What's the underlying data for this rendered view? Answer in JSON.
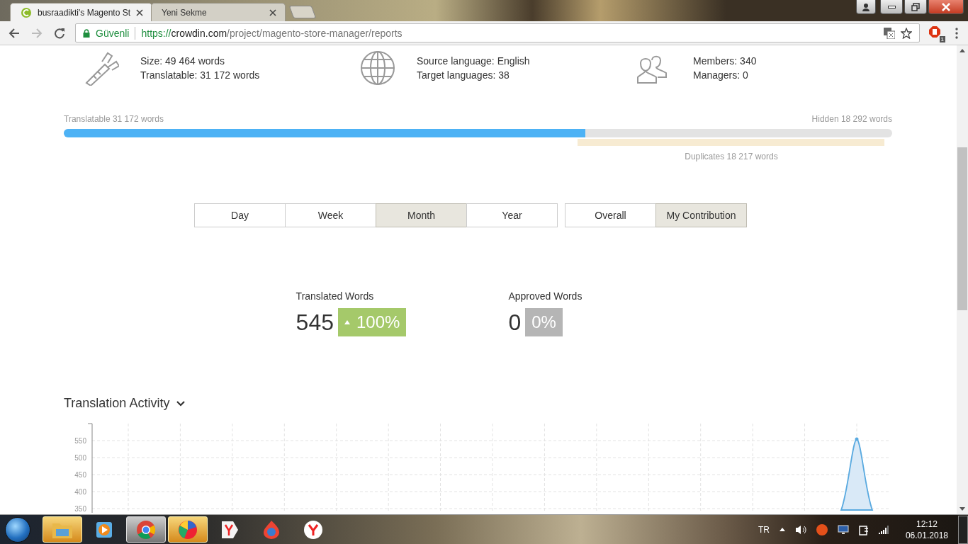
{
  "browser": {
    "tabs": [
      {
        "title": "busraadikti's Magento St",
        "selected": true
      },
      {
        "title": "Yeni Sekme",
        "selected": false
      }
    ],
    "security_label": "Güvenli",
    "url": {
      "scheme": "https://",
      "host": "crowdin.com",
      "path": "/project/magento-store-manager/reports"
    },
    "extension_badge": "1"
  },
  "project_stats": [
    {
      "kind": "size",
      "lines": [
        "Size: 49 464 words",
        "Translatable: 31 172 words"
      ]
    },
    {
      "kind": "languages",
      "lines": [
        "Source language: English",
        "Target languages: 38"
      ]
    },
    {
      "kind": "members",
      "lines": [
        "Members: 340",
        "Managers: 0"
      ]
    }
  ],
  "word_bar": {
    "left_label": "Translatable 31 172 words",
    "right_label": "Hidden 18 292 words",
    "level": 0.63,
    "duplicates_label": "Duplicates 18 217 words"
  },
  "period_tabs": [
    {
      "label": "Day",
      "selected": false
    },
    {
      "label": "Week",
      "selected": false
    },
    {
      "label": "Month",
      "selected": true
    },
    {
      "label": "Year",
      "selected": false
    }
  ],
  "view_tabs": [
    {
      "label": "Overall",
      "selected": false
    },
    {
      "label": "My Contribution",
      "selected": true
    }
  ],
  "summary": [
    {
      "label": "Translated Words",
      "value": "545",
      "change": "100%",
      "rising": true
    },
    {
      "label": "Approved Words",
      "value": "0",
      "change": "0%",
      "rising": false
    }
  ],
  "activity": {
    "title": "Translation Activity",
    "axis_labels": [
      "550",
      "500",
      "450",
      "400",
      "350"
    ]
  },
  "taskbar": {
    "apps": [
      {
        "kind": "folder",
        "active": false,
        "highlighted": true
      },
      {
        "kind": "media",
        "active": false,
        "highlighted": false
      },
      {
        "kind": "chrome",
        "active": true,
        "highlighted": false
      },
      {
        "kind": "ball",
        "active": false,
        "highlighted": true
      },
      {
        "kind": "yandex-flag",
        "active": false,
        "highlighted": false
      },
      {
        "kind": "flame",
        "active": false,
        "highlighted": false
      },
      {
        "kind": "yandex",
        "active": false,
        "highlighted": false
      }
    ],
    "language": "TR",
    "time": "12:12",
    "date": "06.01.2018"
  }
}
